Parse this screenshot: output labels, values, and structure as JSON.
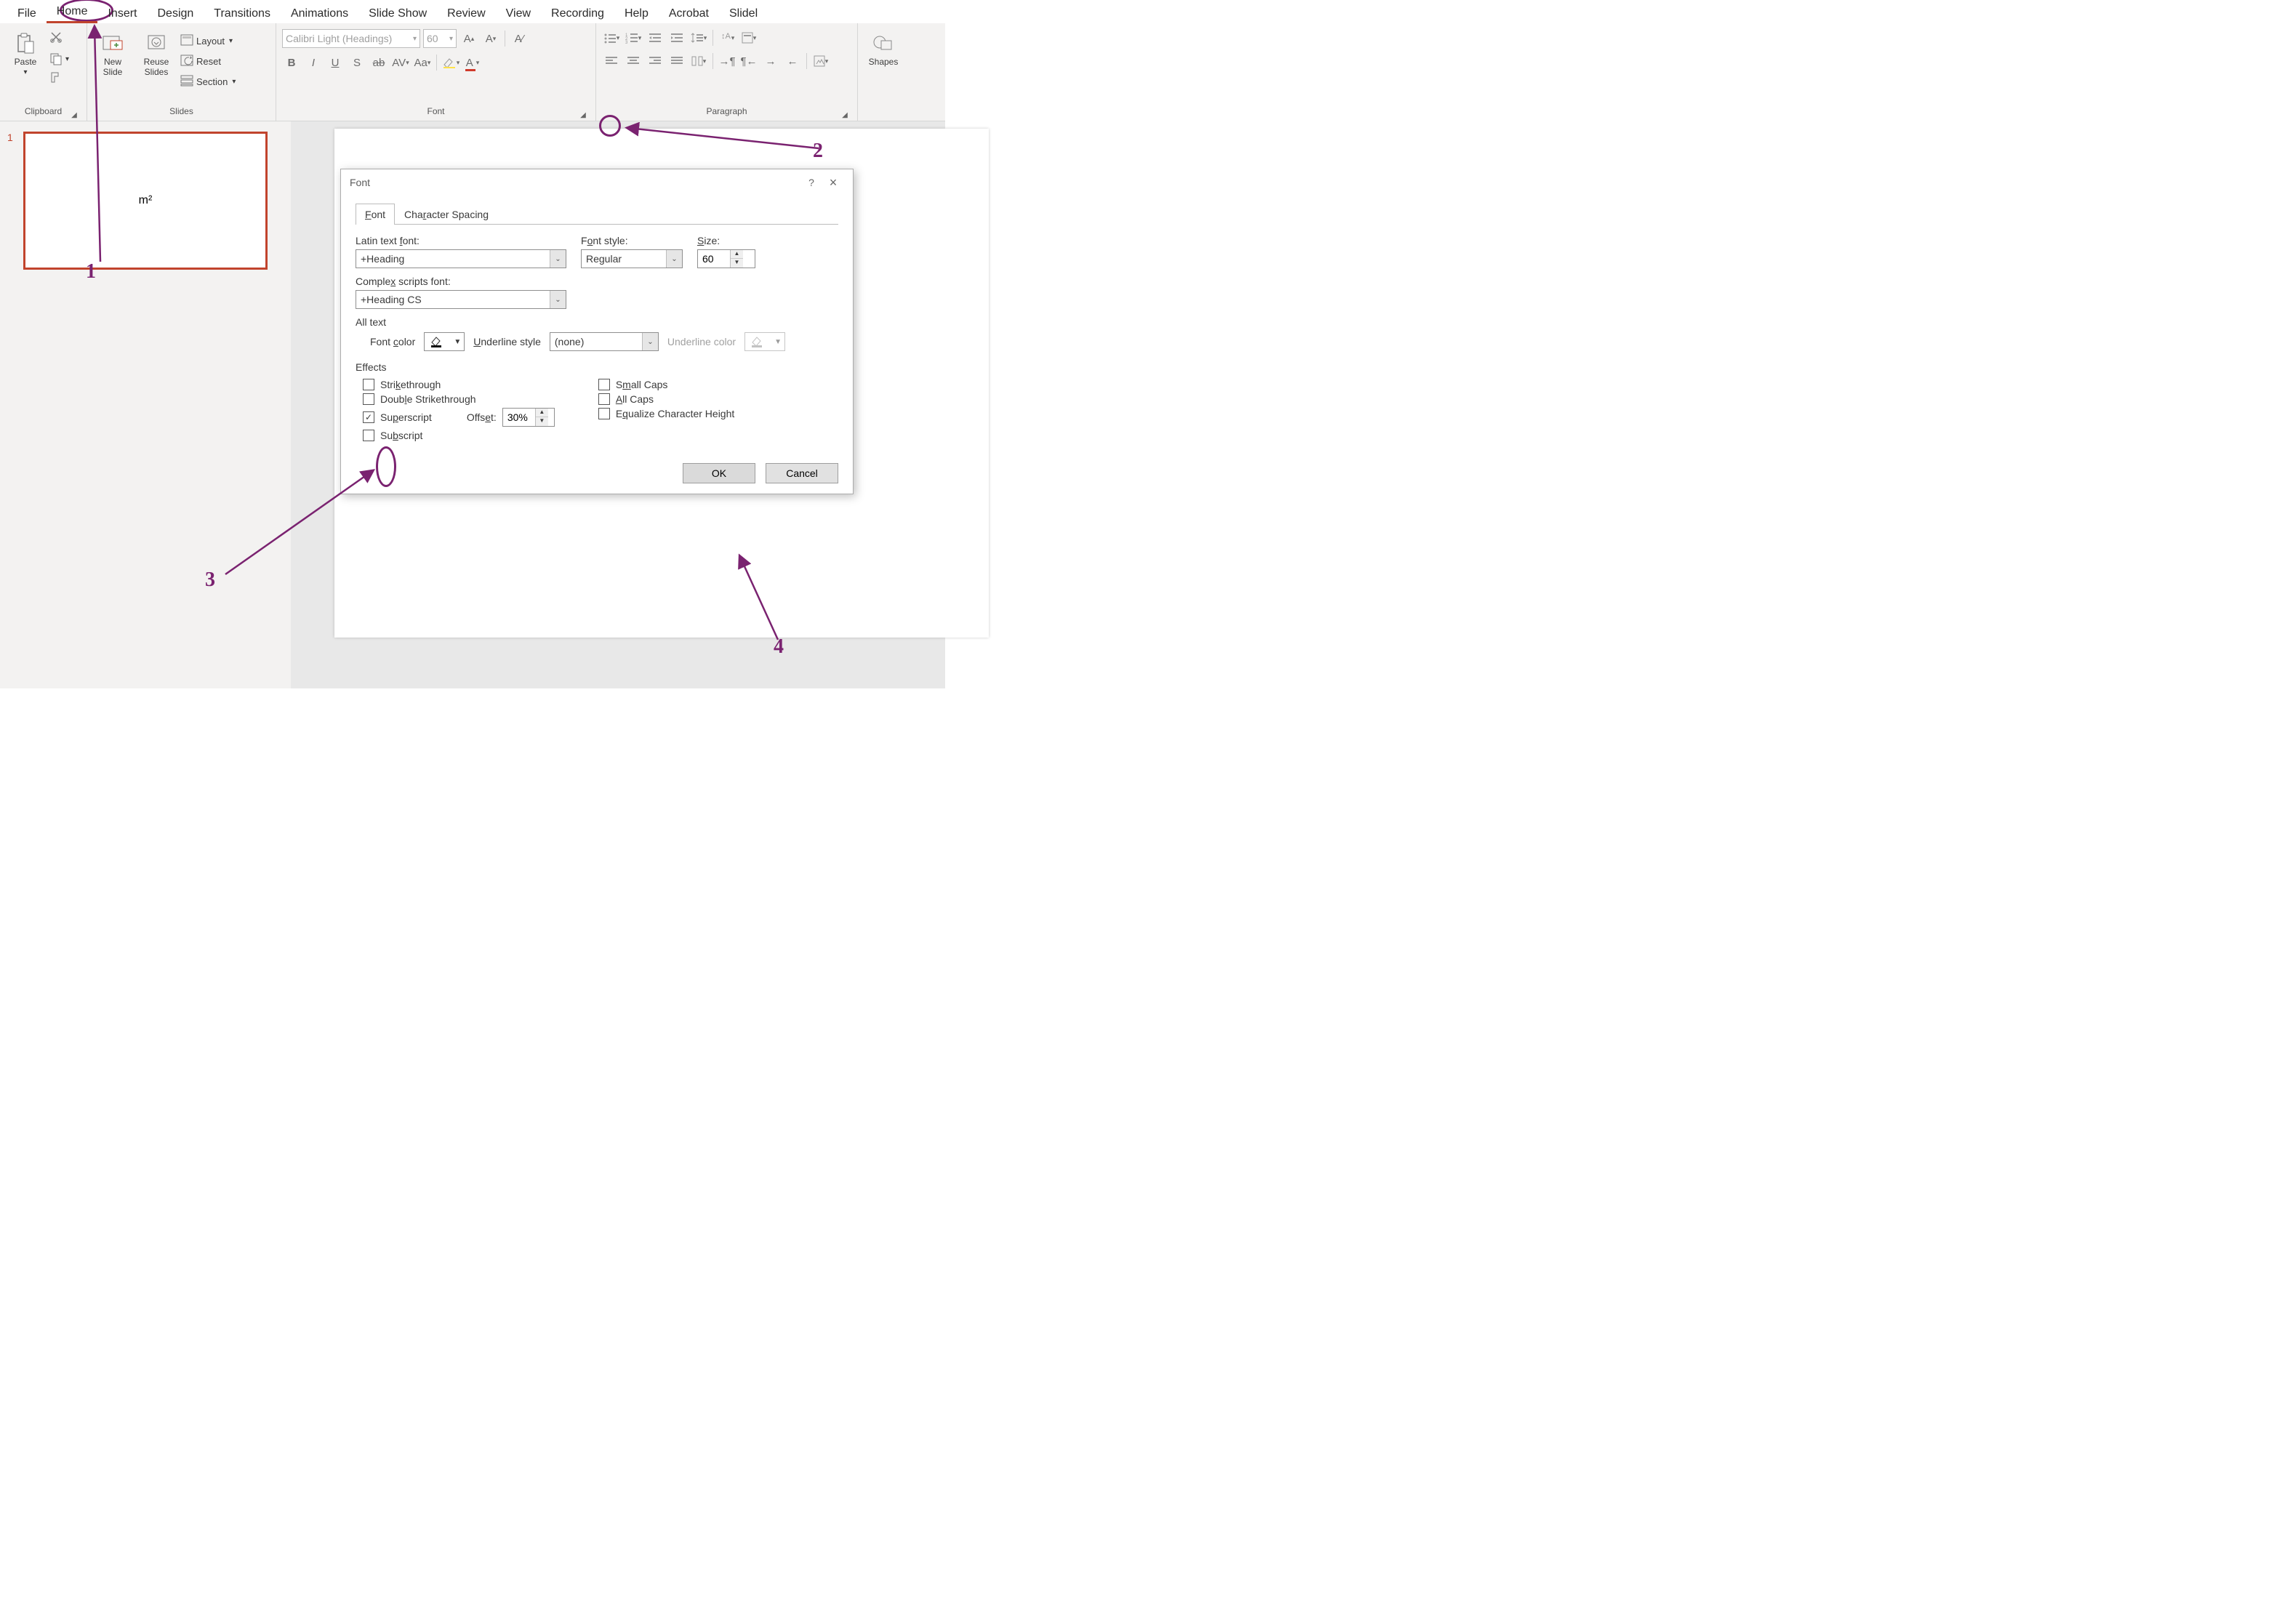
{
  "tabs": [
    "File",
    "Home",
    "Insert",
    "Design",
    "Transitions",
    "Animations",
    "Slide Show",
    "Review",
    "View",
    "Recording",
    "Help",
    "Acrobat",
    "Slidel"
  ],
  "active_tab": "Home",
  "groups": {
    "clipboard": {
      "label": "Clipboard",
      "paste": "Paste"
    },
    "slides": {
      "label": "Slides",
      "new": "New\nSlide",
      "reuse": "Reuse\nSlides",
      "layout": "Layout",
      "reset": "Reset",
      "section": "Section"
    },
    "font": {
      "label": "Font",
      "font_name": "Calibri Light (Headings)",
      "font_size": "60"
    },
    "paragraph": {
      "label": "Paragraph"
    },
    "drawing": {
      "shapes": "Shapes"
    }
  },
  "thumb": {
    "number": "1",
    "text": "m²"
  },
  "dialog": {
    "title": "Font",
    "help": "?",
    "close": "×",
    "tabs": {
      "font": "Font",
      "spacing": "Character Spacing"
    },
    "latin_label": "Latin text font:",
    "latin_value": "+Heading",
    "style_label": "Font style:",
    "style_value": "Regular",
    "size_label": "Size:",
    "size_value": "60",
    "complex_label": "Complex scripts font:",
    "complex_value": "+Heading CS",
    "alltext": "All text",
    "fontcolor": "Font color",
    "underline_style": "Underline style",
    "underline_value": "(none)",
    "underline_color": "Underline color",
    "effects": "Effects",
    "cb_strike": "Strikethrough",
    "cb_dblstrike": "Double Strikethrough",
    "cb_super": "Superscript",
    "cb_sub": "Subscript",
    "offset_label": "Offset:",
    "offset_value": "30%",
    "cb_smallcaps": "Small Caps",
    "cb_allcaps": "All Caps",
    "cb_equalize": "Equalize Character Height",
    "ok": "OK",
    "cancel": "Cancel"
  },
  "annotations": {
    "n1": "1",
    "n2": "2",
    "n3": "3",
    "n4": "4"
  }
}
